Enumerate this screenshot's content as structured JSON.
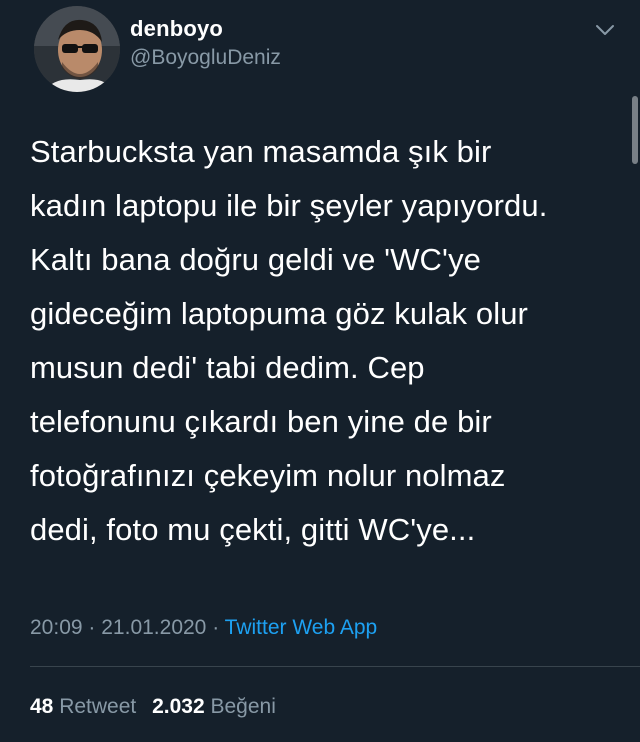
{
  "tweet": {
    "author": {
      "display_name": "denboyo",
      "handle": "@BoyogluDeniz",
      "avatar_icon": "user-avatar-photo"
    },
    "more_icon": "chevron-down-icon",
    "text": "Starbucksta yan masamda şık bir\nkadın laptopu ile bir şeyler yapıyordu.\nKaltı bana doğru geldi ve 'WC'ye\ngideceğim laptopuma göz kulak olur\nmusun dedi' tabi dedim. Cep\ntelefonunu çıkardı ben yine de bir\nfotoğrafınızı çekeyim nolur nolmaz\ndedi, foto mu çekti, gitti WC'ye...",
    "time": "20:09",
    "separator": "·",
    "date": "21.01.2020",
    "source": "Twitter Web App",
    "retweets": {
      "count": "48",
      "label": "Retweet"
    },
    "likes": {
      "count": "2.032",
      "label": "Beğeni"
    }
  },
  "colors": {
    "background": "#15202b",
    "secondary_text": "#8899a6",
    "accent": "#1da1f2",
    "divider": "#38444d"
  }
}
